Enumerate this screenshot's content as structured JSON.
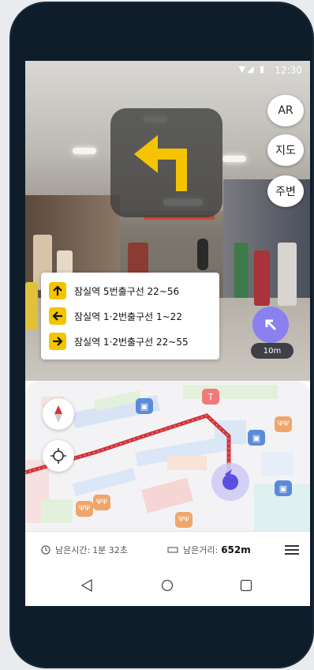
{
  "status_bar": {
    "time": "12:30"
  },
  "ar_view": {
    "side_buttons": [
      "AR",
      "지도",
      "주변"
    ],
    "guide": [
      {
        "direction": "up",
        "text": "잠실역 5번출구선 22~56"
      },
      {
        "direction": "left",
        "text": "잠실역 1·2번출구선 1~22"
      },
      {
        "direction": "right",
        "text": "잠실역 1·2번출구선 22~55"
      }
    ],
    "distance_label": "10m"
  },
  "map": {
    "route_color": "#d0343a",
    "location_color": "#5a50e0"
  },
  "info_bar": {
    "time_label": "남은시간:",
    "time_value": "1분 32초",
    "distance_label": "남은거리:",
    "distance_value": "652m"
  },
  "colors": {
    "accent_yellow": "#f4c400",
    "fab_purple": "#8a80f0"
  }
}
